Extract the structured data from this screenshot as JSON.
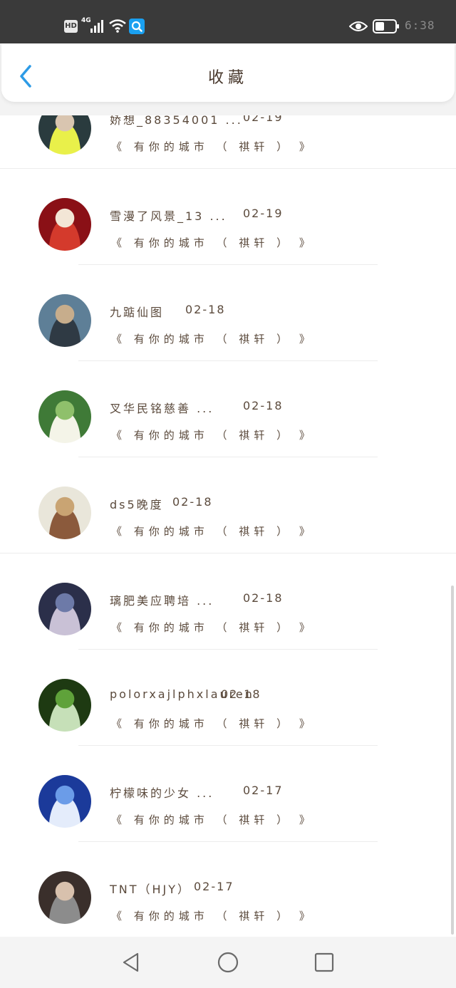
{
  "status_bar": {
    "hd": "HD",
    "network": "4G",
    "time": "6:38",
    "icons": [
      "hd-icon",
      "signal-icon",
      "wifi-icon",
      "search-app-icon",
      "eye-icon",
      "battery-icon"
    ]
  },
  "header": {
    "title": "收藏",
    "back_icon": "chevron-left-icon"
  },
  "list": {
    "items": [
      {
        "name": "娇想_88354001 ...",
        "date": "02-19",
        "title": "《 有你的城市 （ 祺轩 ） 》",
        "avatar_colors": [
          "#2a3b3e",
          "#d9c5b0",
          "#e9f04a"
        ]
      },
      {
        "name": "雪漫了风景_13 ...",
        "date": "02-19",
        "title": "《 有你的城市 （ 祺轩 ） 》",
        "avatar_colors": [
          "#8a1016",
          "#f3e6d6",
          "#d43a2c"
        ]
      },
      {
        "name": "九踮仙图",
        "date": "02-18",
        "title": "《 有你的城市 （ 祺轩 ） 》",
        "avatar_colors": [
          "#5e7f97",
          "#c7ad8c",
          "#2f3a44"
        ]
      },
      {
        "name": "叉华民铭慈善 ...",
        "date": "02-18",
        "title": "《 有你的城市 （ 祺轩 ） 》",
        "avatar_colors": [
          "#3f7a37",
          "#8fc06b",
          "#f4f4e8"
        ]
      },
      {
        "name": "ds5晚度",
        "date": "02-18",
        "title": "《 有你的城市 （ 祺轩 ） 》",
        "avatar_colors": [
          "#e9e6da",
          "#c9a473",
          "#8b5a3c"
        ]
      },
      {
        "name": "璃肥美应聘培 ...",
        "date": "02-18",
        "title": "《 有你的城市 （ 祺轩 ） 》",
        "avatar_colors": [
          "#2b2f4a",
          "#6d7aa8",
          "#c9c1d6"
        ]
      },
      {
        "name": "polorxajlphxlauren",
        "date": "02-18",
        "title": "《 有你的城市 （ 祺轩 ） 》",
        "avatar_colors": [
          "#1e3a12",
          "#5fa23a",
          "#c6e0b8"
        ]
      },
      {
        "name": "柠檬味的少女 ...",
        "date": "02-17",
        "title": "《 有你的城市 （ 祺轩 ） 》",
        "avatar_colors": [
          "#1b3a9a",
          "#6b9ce8",
          "#e4ecfb"
        ]
      },
      {
        "name": "TNT（HJY）",
        "date": "02-17",
        "title": "《 有你的城市 （ 祺轩 ） 》",
        "avatar_colors": [
          "#3a2f2b",
          "#d8c1ad",
          "#8c8c8c"
        ]
      }
    ]
  },
  "nav": {
    "icons": [
      "back-triangle-icon",
      "home-circle-icon",
      "recents-square-icon"
    ]
  }
}
